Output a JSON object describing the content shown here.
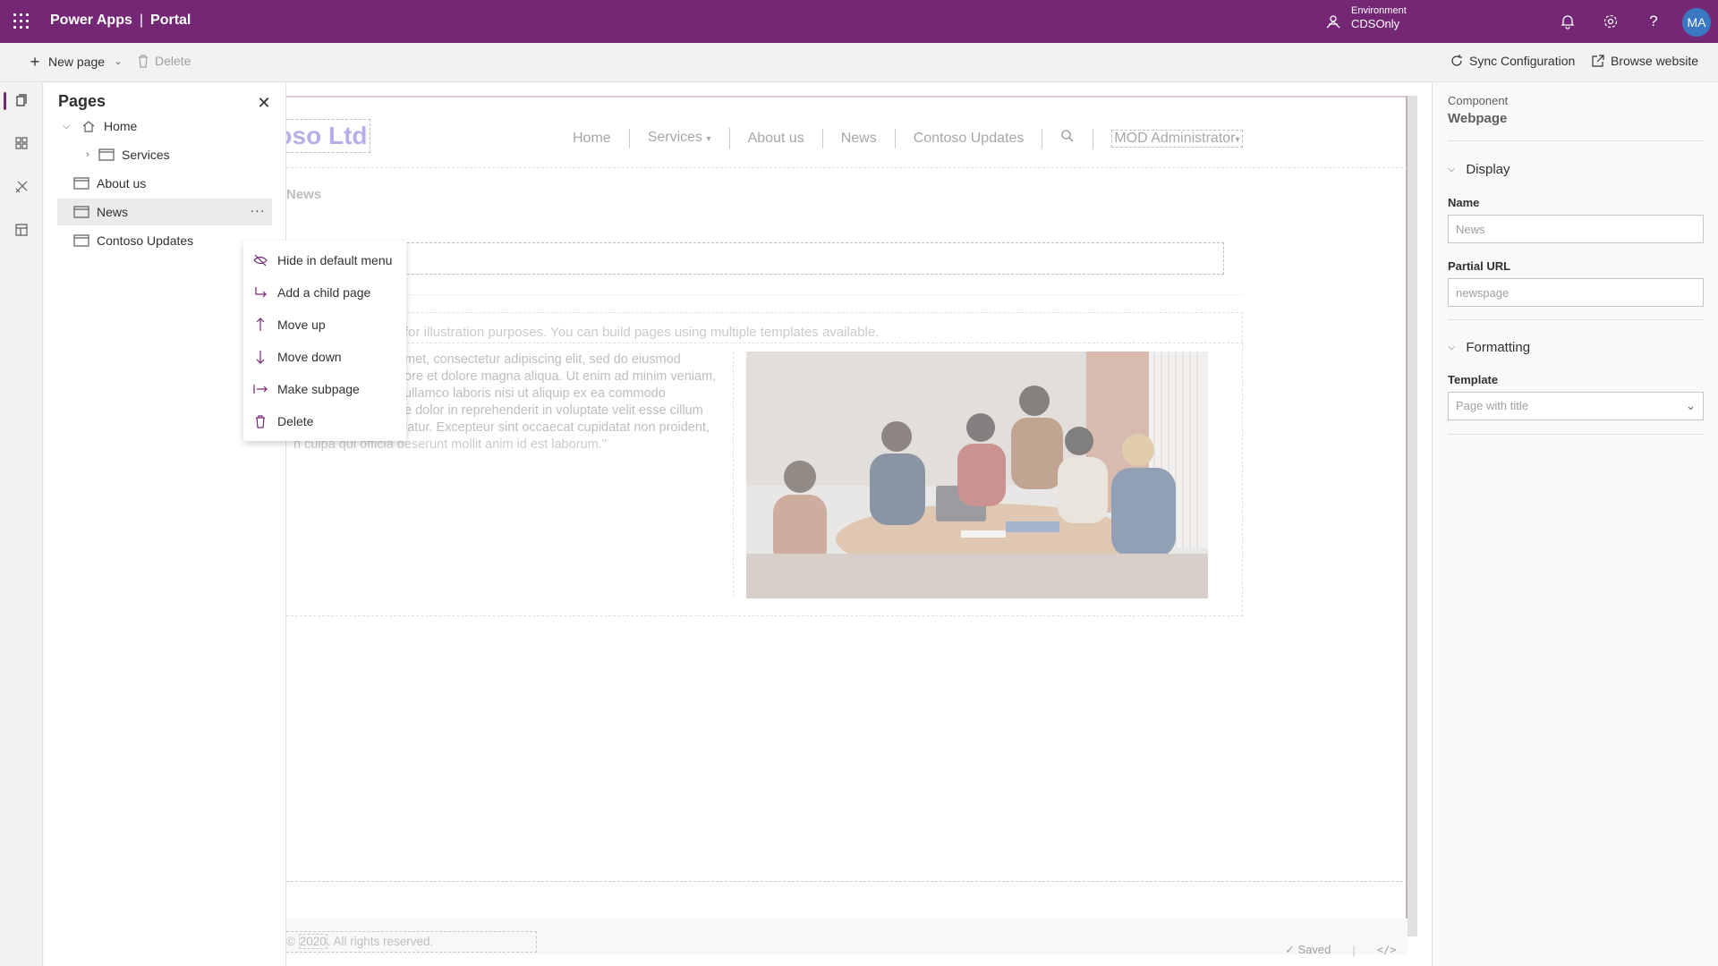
{
  "header": {
    "app_name": "Power Apps",
    "separator": "|",
    "product": "Portal",
    "environment_label": "Environment",
    "environment_value": "CDSOnly",
    "avatar_initials": "MA",
    "brand_color": "#742774"
  },
  "commands": {
    "new_page": "New page",
    "delete": "Delete",
    "sync": "Sync Configuration",
    "browse": "Browse website"
  },
  "pages_panel": {
    "title": "Pages",
    "items": [
      {
        "label": "Home"
      },
      {
        "label": "Services"
      },
      {
        "label": "About us"
      },
      {
        "label": "News"
      },
      {
        "label": "Contoso Updates"
      }
    ]
  },
  "context_menu": {
    "items": [
      {
        "label": "Hide in default menu",
        "icon": "eye-hide-icon"
      },
      {
        "label": "Add a child page",
        "icon": "child-page-icon"
      },
      {
        "label": "Move up",
        "icon": "arrow-up-icon"
      },
      {
        "label": "Move down",
        "icon": "arrow-down-icon"
      },
      {
        "label": "Make subpage",
        "icon": "subpage-icon"
      },
      {
        "label": "Delete",
        "icon": "trash-icon"
      }
    ]
  },
  "canvas": {
    "logo": "ntoso Ltd",
    "nav": [
      "Home",
      "Services",
      "About us",
      "News",
      "Contoso Updates"
    ],
    "user": "MOD Administrator",
    "breadcrumb": "News",
    "intro": "for illustration purposes. You can build pages using multiple templates available.",
    "lorem_lines": [
      "met, consectetur adipiscing elit, sed do eiusmod",
      "ore et dolore magna aliqua. Ut enim ad minim veniam,",
      "ullamco laboris nisi ut aliquip ex ea commodo",
      "e dolor in reprehenderit in voluptate velit esse cillum",
      "iatur. Excepteur sint occaecat cupidatat non proident,",
      "n culpa qui officia deserunt mollit anim id est laborum.\""
    ],
    "copyright_prefix": "©",
    "copyright_year": "2020",
    "copyright_rest": ". All rights reserved."
  },
  "status": {
    "saved": "Saved",
    "code": "</>"
  },
  "properties": {
    "component_label": "Component",
    "component_value": "Webpage",
    "display_section": "Display",
    "name_label": "Name",
    "name_value": "News",
    "url_label": "Partial URL",
    "url_value": "newspage",
    "formatting_section": "Formatting",
    "template_label": "Template",
    "template_value": "Page with title"
  }
}
